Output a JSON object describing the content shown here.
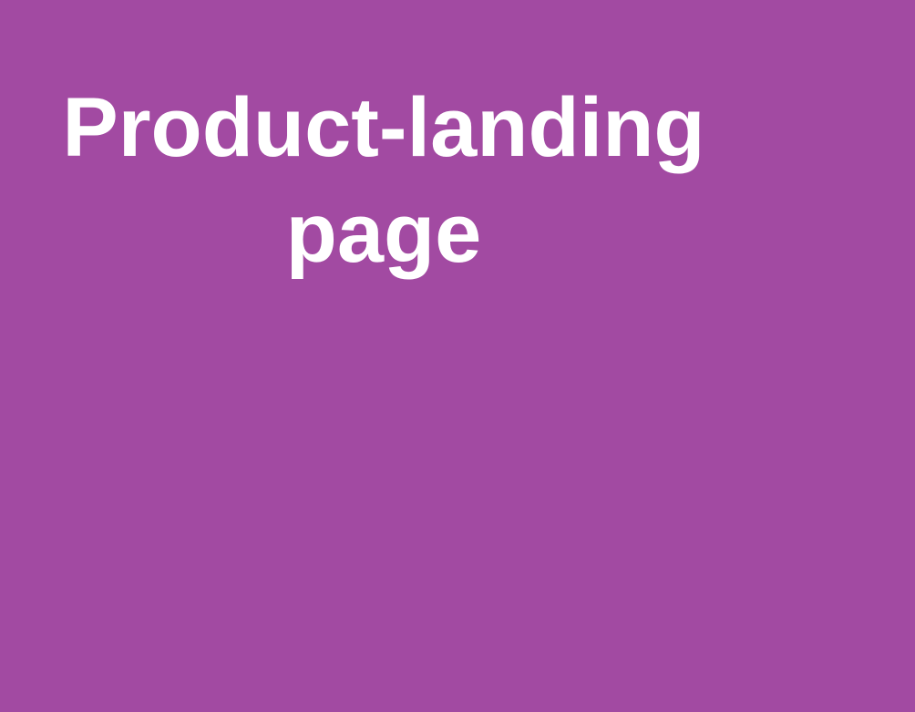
{
  "page": {
    "title": "Product-landing page",
    "background_color": "#a24aa2",
    "text_color": "#ffffff"
  }
}
